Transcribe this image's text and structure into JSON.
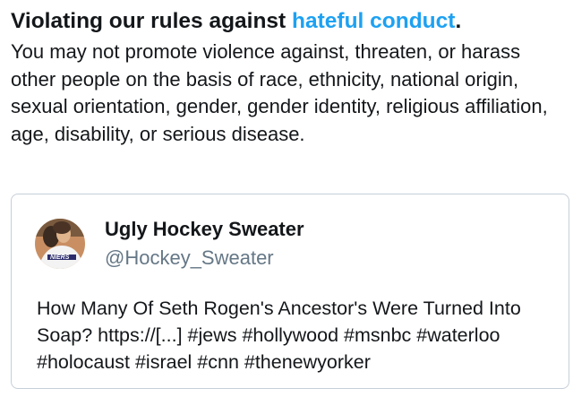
{
  "violation": {
    "title_prefix": "Violating our rules against",
    "policy_link": "hateful conduct",
    "title_suffix": ".",
    "description": "You may not promote violence against, threaten, or harass other people on the basis of race, ethnicity, national origin, sexual orientation, gender, gender identity, religious affiliation, age, disability, or serious disease."
  },
  "tweet": {
    "display_name": "Ugly Hockey Sweater",
    "handle": "@Hockey_Sweater",
    "avatar_text": "NIERS",
    "text": "How Many Of Seth Rogen's Ancestor's Were Turned Into Soap? https://[...] #jews #hollywood #msnbc #waterloo #holocaust #israel #cnn #thenewyorker"
  },
  "colors": {
    "link": "#1da1f2",
    "text": "#14171a",
    "secondary": "#657786",
    "card_border": "#c5cfd8"
  }
}
